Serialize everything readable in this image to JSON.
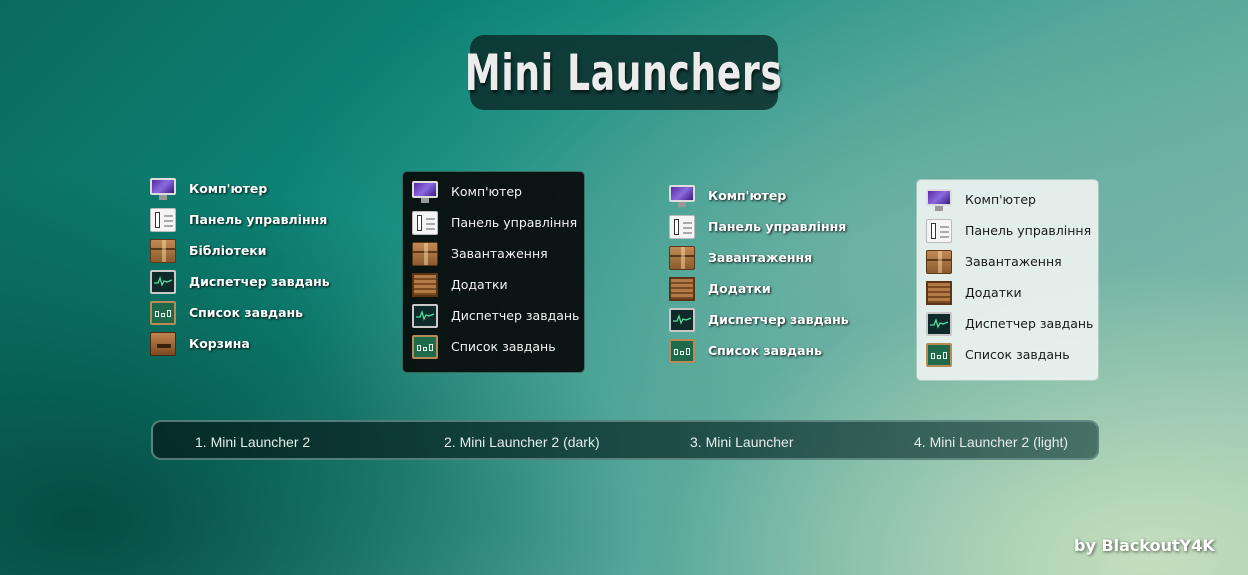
{
  "title": "Mini Launchers",
  "launchers": [
    {
      "items": [
        {
          "icon": "computer-icon",
          "label": "Комп'ютер"
        },
        {
          "icon": "control-panel-icon",
          "label": "Панель управління"
        },
        {
          "icon": "libraries-icon",
          "label": "Бібліотеки"
        },
        {
          "icon": "task-manager-icon",
          "label": "Диспетчер завдань"
        },
        {
          "icon": "task-list-icon",
          "label": "Список завдань"
        },
        {
          "icon": "recycle-bin-icon",
          "label": "Корзина"
        }
      ]
    },
    {
      "items": [
        {
          "icon": "computer-icon",
          "label": "Комп'ютер"
        },
        {
          "icon": "control-panel-icon",
          "label": "Панель управління"
        },
        {
          "icon": "downloads-icon",
          "label": "Завантаження"
        },
        {
          "icon": "applications-icon",
          "label": "Додатки"
        },
        {
          "icon": "task-manager-icon",
          "label": "Диспетчер завдань"
        },
        {
          "icon": "task-list-icon",
          "label": "Список завдань"
        }
      ]
    },
    {
      "items": [
        {
          "icon": "computer-icon",
          "label": "Комп'ютер"
        },
        {
          "icon": "control-panel-icon",
          "label": "Панель управління"
        },
        {
          "icon": "downloads-icon",
          "label": "Завантаження"
        },
        {
          "icon": "applications-icon",
          "label": "Додатки"
        },
        {
          "icon": "task-manager-icon",
          "label": "Диспетчер завдань"
        },
        {
          "icon": "task-list-icon",
          "label": "Список завдань"
        }
      ]
    },
    {
      "items": [
        {
          "icon": "computer-icon",
          "label": "Комп'ютер"
        },
        {
          "icon": "control-panel-icon",
          "label": "Панель управління"
        },
        {
          "icon": "downloads-icon",
          "label": "Завантаження"
        },
        {
          "icon": "applications-icon",
          "label": "Додатки"
        },
        {
          "icon": "task-manager-icon",
          "label": "Диспетчер завдань"
        },
        {
          "icon": "task-list-icon",
          "label": "Список завдань"
        }
      ]
    }
  ],
  "captions": [
    "1. Mini Launcher 2",
    "2. Mini Launcher 2 (dark)",
    "3. Mini Launcher",
    "4. Mini Launcher 2 (light)"
  ],
  "credit": "by BlackoutY4K",
  "colors": {
    "dark_panel": "#080e0d",
    "light_panel": "#ecf2f0",
    "background_teal": "#0d8a7c"
  }
}
